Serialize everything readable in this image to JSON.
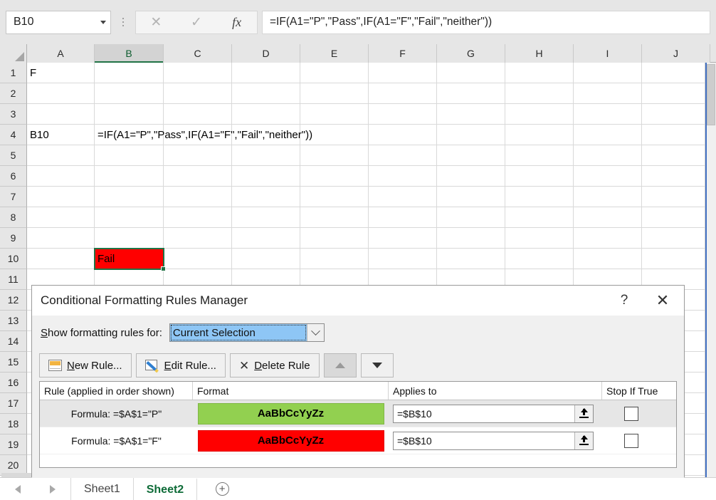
{
  "formula_bar": {
    "name_box_value": "B10",
    "cancel_icon": "x-icon",
    "enter_icon": "check-icon",
    "function_icon": "fx-icon",
    "formula_value": "=IF(A1=\"P\",\"Pass\",IF(A1=\"F\",\"Fail\",\"neither\"))"
  },
  "grid": {
    "columns": [
      "A",
      "B",
      "C",
      "D",
      "E",
      "F",
      "G",
      "H",
      "I",
      "J"
    ],
    "selected_column": "B",
    "rows": [
      "1",
      "2",
      "3",
      "4",
      "5",
      "6",
      "7",
      "8",
      "9",
      "10",
      "11",
      "12",
      "13",
      "14",
      "15",
      "16",
      "17",
      "18",
      "19",
      "20"
    ],
    "cells": {
      "A1": "F",
      "A4": "B10",
      "B4": "=IF(A1=\"P\",\"Pass\",IF(A1=\"F\",\"Fail\",\"neither\"))",
      "B10": "Fail"
    },
    "active_cell": "B10",
    "active_cell_fill": "#FF0000",
    "active_cell_border": "#217346"
  },
  "sheet_tabs": {
    "prev_icon": "arrow-left-icon",
    "next_icon": "arrow-right-icon",
    "tabs": [
      {
        "label": "Sheet1",
        "active": false
      },
      {
        "label": "Sheet2",
        "active": true
      }
    ],
    "add_sheet_icon": "plus-circle-icon",
    "add_sheet_label": "+"
  },
  "dialog": {
    "title": "Conditional Formatting Rules Manager",
    "help_label": "?",
    "close_label": "✕",
    "show_rules_label": "Show formatting rules for:",
    "show_rules_label_accel": "S",
    "show_rules_label_rest": "how formatting rules for:",
    "show_rules_value": "Current Selection",
    "toolbar": {
      "new_rule_accel": "N",
      "new_rule_rest": "ew Rule...",
      "edit_rule_accel": "E",
      "edit_rule_rest": "dit Rule...",
      "delete_rule_accel": "D",
      "delete_rule_rest": "elete Rule",
      "move_up_icon": "arrow-up-icon",
      "move_down_icon": "arrow-down-icon",
      "move_up_enabled": false,
      "move_down_enabled": true
    },
    "table": {
      "headers": [
        "Rule (applied in order shown)",
        "Format",
        "Applies to",
        "Stop If True"
      ],
      "rows": [
        {
          "rule": "Formula: =$A$1=\"P\"",
          "format_preview_text": "AaBbCcYyZz",
          "format_bg": "#92D050",
          "format_fg": "#000000",
          "applies_to": "=$B$10",
          "stop_if_true": false,
          "selected": true
        },
        {
          "rule": "Formula: =$A$1=\"F\"",
          "format_preview_text": "AaBbCcYyZz",
          "format_bg": "#FF0000",
          "format_fg": "#000000",
          "applies_to": "=$B$10",
          "stop_if_true": false,
          "selected": false
        }
      ]
    }
  }
}
